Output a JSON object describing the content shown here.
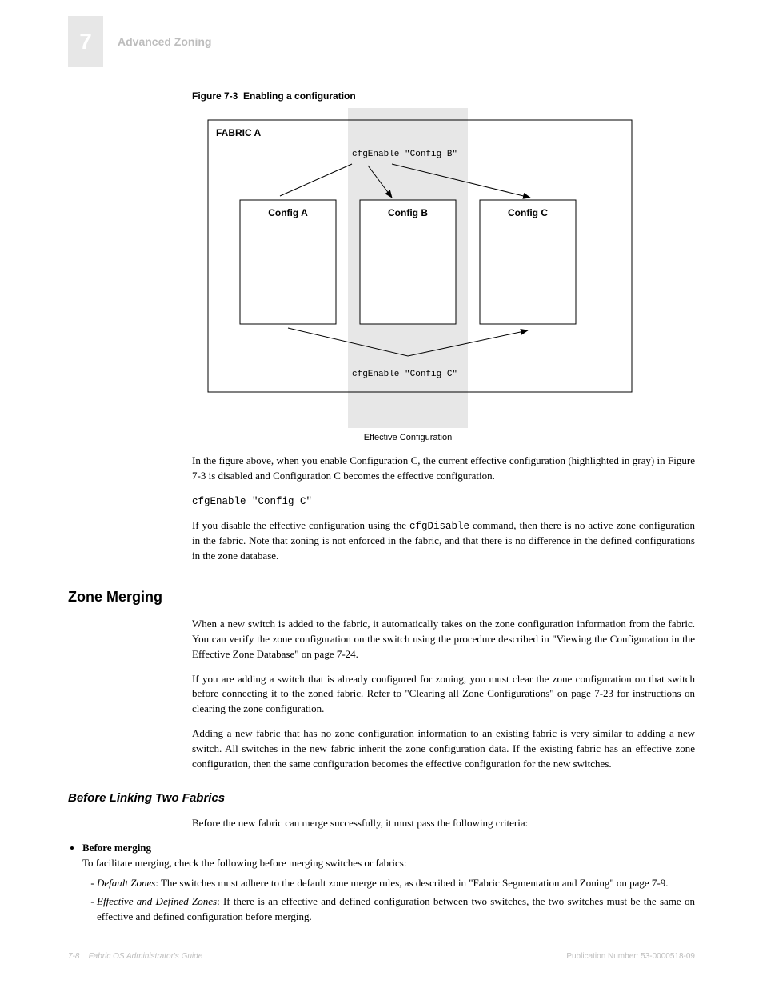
{
  "header": {
    "chapter_number": "7",
    "chapter_label": "Advanced Zoning"
  },
  "figure": {
    "caption": "Figure 7-3",
    "title": "Enabling a configuration",
    "fabric_label": "FABRIC A",
    "config_a": "Config A",
    "config_b": "Config B",
    "config_c": "Config C",
    "effective_label": "Effective Configuration",
    "enable_top": "cfgEnable \"Config B\"",
    "enable_bottom": "cfgEnable \"Config C\""
  },
  "paragraphs": {
    "p1": "In the figure above, when you enable Configuration C, the current effective configuration (highlighted in gray) in Figure 7-3 is disabled and Configuration C becomes the effective configuration.",
    "p1_cmd": "cfgEnable \"Config C\"",
    "p2_pre": "If you disable the effective configuration using the ",
    "p2_cmd": "cfgDisable",
    "p2_post": " command, then there is no active zone configuration in the fabric. Note that zoning is not enforced in the fabric, and that there is no difference in the defined configurations in the zone database."
  },
  "sections": {
    "merging": {
      "title": "Zone Merging",
      "intro": "When a new switch is added to the fabric, it automatically takes on the zone configuration information from the fabric. You can verify the zone configuration on the switch using the procedure described in \"Viewing the Configuration in the Effective Zone Database\" on page 7-24.",
      "p2": "If you are adding a switch that is already configured for zoning, you must clear the zone configuration on that switch before connecting it to the zoned fabric. Refer to \"Clearing all Zone Configurations\" on page 7-23 for instructions on clearing the zone configuration.",
      "p3": "Adding a new fabric that has no zone configuration information to an existing fabric is very similar to adding a new switch. All switches in the new fabric inherit the zone configuration data. If the existing fabric has an effective zone configuration, then the same configuration becomes the effective configuration for the new switches.",
      "xref_view": "\"Viewing the Configuration in the Effective Zone Database\"",
      "xref_view_page": "page 7-24",
      "xref_clear": "\"Clearing all Zone Configurations\"",
      "xref_clear_page": "page 7-23"
    },
    "prejoin": {
      "title": "Before Linking Two Fabrics",
      "intro": "Before the new fabric can merge successfully, it must pass the following criteria:",
      "bullets": [
        {
          "lead": "Before merging",
          "body": "To facilitate merging, check the following before merging switches or fabrics:"
        },
        {
          "lead": "Default Zones",
          "body": "The switches must adhere to the default zone merge rules, as described in \"Fabric Segmentation and Zoning\" on page 7-9.",
          "xref": "\"Fabric Segmentation and Zoning\"",
          "xref_page": "page 7-9"
        },
        {
          "lead": "Effective and Defined Zones",
          "body": "If there is an effective and defined configuration between two switches, the two switches must be the same on effective and defined configuration before merging."
        }
      ]
    }
  },
  "footer": {
    "left_page": "7-8",
    "left_title": "Fabric OS Administrator's Guide",
    "right": "Publication Number: 53-0000518-09"
  }
}
